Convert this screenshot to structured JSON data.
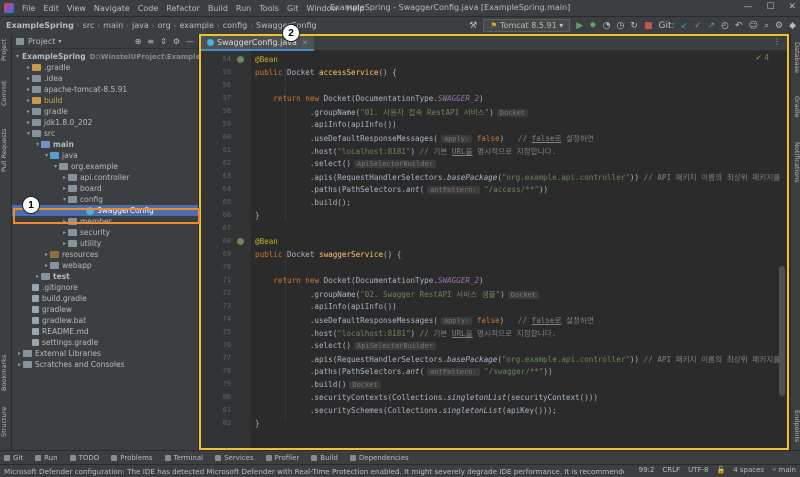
{
  "menu": {
    "items": [
      "File",
      "Edit",
      "View",
      "Navigate",
      "Code",
      "Refactor",
      "Build",
      "Run",
      "Tools",
      "Git",
      "Window",
      "Help"
    ],
    "title": "ExampleSpring - SwaggerConfig.java [ExampleSpring.main]"
  },
  "navbar": {
    "crumbs": [
      "ExampleSpring",
      "src",
      "main",
      "java",
      "org",
      "example",
      "config",
      "SwaggerConfig"
    ],
    "run_config": "Tomcat 8.5.91",
    "git_label": "Git:"
  },
  "left_strip": {
    "tabs": [
      "Project",
      "Commit",
      "Pull Requests",
      "Bookmarks",
      "Structure"
    ]
  },
  "right_strip": {
    "tabs": [
      "Database",
      "Gradle",
      "Notifications",
      "Endpoints"
    ]
  },
  "project_panel": {
    "title": "Project",
    "tree": [
      {
        "label": "ExampleSpring",
        "path": "D:\\WinstelUProject\\ExampleSpring",
        "indent": 0,
        "arrow": "▾",
        "icon": "fold-b",
        "bold": true
      },
      {
        "label": ".gradle",
        "indent": 1,
        "arrow": "▸",
        "icon": "fold-o"
      },
      {
        "label": ".idea",
        "indent": 1,
        "arrow": "▸",
        "icon": "fold"
      },
      {
        "label": "apache-tomcat-8.5.91",
        "indent": 1,
        "arrow": "▸",
        "icon": "fold"
      },
      {
        "label": "build",
        "indent": 1,
        "arrow": "▸",
        "icon": "fold-o",
        "highlight": true
      },
      {
        "label": "gradle",
        "indent": 1,
        "arrow": "▸",
        "icon": "fold"
      },
      {
        "label": "jdk1.8.0_202",
        "indent": 1,
        "arrow": "▸",
        "icon": "fold"
      },
      {
        "label": "src",
        "indent": 1,
        "arrow": "▾",
        "icon": "fold"
      },
      {
        "label": "main",
        "indent": 2,
        "arrow": "▾",
        "icon": "fold-b",
        "bold": true
      },
      {
        "label": "java",
        "indent": 3,
        "arrow": "▾",
        "icon": "fold-s"
      },
      {
        "label": "org.example",
        "indent": 4,
        "arrow": "▾",
        "icon": "fold"
      },
      {
        "label": "api.controller",
        "indent": 5,
        "arrow": "▸",
        "icon": "fold"
      },
      {
        "label": "board",
        "indent": 5,
        "arrow": "▸",
        "icon": "fold"
      },
      {
        "label": "config",
        "indent": 5,
        "arrow": "▾",
        "icon": "fold"
      },
      {
        "label": "SwaggerConfig",
        "indent": 7,
        "arrow": "",
        "icon": "jcls",
        "selected": true
      },
      {
        "label": "member",
        "indent": 5,
        "arrow": "▸",
        "icon": "fold"
      },
      {
        "label": "security",
        "indent": 5,
        "arrow": "▸",
        "icon": "fold"
      },
      {
        "label": "utility",
        "indent": 5,
        "arrow": "▸",
        "icon": "fold"
      },
      {
        "label": "resources",
        "indent": 3,
        "arrow": "▸",
        "icon": "fold-r"
      },
      {
        "label": "webapp",
        "indent": 3,
        "arrow": "▸",
        "icon": "fold"
      },
      {
        "label": "test",
        "indent": 2,
        "arrow": "▸",
        "icon": "fold",
        "bold": true
      },
      {
        "label": ".gitignore",
        "indent": 1,
        "arrow": "",
        "icon": "file"
      },
      {
        "label": "build.gradle",
        "indent": 1,
        "arrow": "",
        "icon": "file"
      },
      {
        "label": "gradlew",
        "indent": 1,
        "arrow": "",
        "icon": "file"
      },
      {
        "label": "gradlew.bat",
        "indent": 1,
        "arrow": "",
        "icon": "file"
      },
      {
        "label": "README.md",
        "indent": 1,
        "arrow": "",
        "icon": "file"
      },
      {
        "label": "settings.gradle",
        "indent": 1,
        "arrow": "",
        "icon": "file"
      },
      {
        "label": "External Libraries",
        "indent": 0,
        "arrow": "▸",
        "icon": "fold"
      },
      {
        "label": "Scratches and Consoles",
        "indent": 0,
        "arrow": "▸",
        "icon": "fold"
      }
    ]
  },
  "editor": {
    "tab_label": "SwaggerConfig.java",
    "analysis": "✔ 4",
    "line_numbers": [
      54,
      55,
      56,
      57,
      58,
      59,
      60,
      61,
      62,
      63,
      64,
      65,
      66,
      67,
      68,
      69,
      70,
      71,
      72,
      73,
      74,
      75,
      76,
      77,
      78,
      79,
      80,
      81,
      82
    ],
    "bean_lines": [
      54,
      68
    ],
    "lines": [
      [
        [
          "an",
          "@Bean"
        ]
      ],
      [
        [
          "kw",
          "public "
        ],
        [
          "",
          "Docket "
        ],
        [
          "fn",
          "accessService"
        ],
        [
          "",
          "() {"
        ]
      ],
      [],
      [
        [
          "",
          "    "
        ],
        [
          "kw",
          "return new "
        ],
        [
          "",
          "Docket(DocumentationType."
        ],
        [
          "it",
          "SWAGGER_2"
        ],
        [
          "",
          ")"
        ]
      ],
      [
        [
          "",
          "            .groupName("
        ],
        [
          "st",
          "\"01. 사용자 접속 RestAPI 서비스\""
        ],
        [
          "",
          ")"
        ],
        [
          "hint",
          "Docket"
        ]
      ],
      [
        [
          "",
          "            .apiInfo(apiInfo())"
        ]
      ],
      [
        [
          "",
          "            .useDefaultResponseMessages("
        ],
        [
          "hint",
          "apply:"
        ],
        [
          "kw",
          " false"
        ],
        [
          "",
          ")   "
        ],
        [
          "cm",
          "// "
        ],
        [
          "cm u",
          "false로"
        ],
        [
          "cm",
          " 설정하면"
        ]
      ],
      [
        [
          "",
          "            .host("
        ],
        [
          "st",
          "\"localhost:8181\""
        ],
        [
          "",
          ") "
        ],
        [
          "cm",
          "// 기본 "
        ],
        [
          "cm u",
          "URL을"
        ],
        [
          "cm",
          " 명시적으로 지정합니다."
        ]
      ],
      [
        [
          "",
          "            .select()"
        ],
        [
          "hint",
          "ApiSelectorBuilder"
        ]
      ],
      [
        [
          "",
          "            .apis(RequestHandlerSelectors."
        ],
        [
          "sti",
          "basePackage"
        ],
        [
          "",
          "("
        ],
        [
          "st",
          "\"org.example.api.controller\""
        ],
        [
          "",
          ")) "
        ],
        [
          "cm",
          "// API 패키지 이름의 최상위 패키지를 입력"
        ]
      ],
      [
        [
          "",
          "            .paths(PathSelectors."
        ],
        [
          "sti",
          "ant"
        ],
        [
          "",
          "("
        ],
        [
          "hint",
          "antPattern:"
        ],
        [
          "st",
          " \"/access/**\""
        ],
        [
          "",
          "))"
        ]
      ],
      [
        [
          "",
          "            .build();"
        ]
      ],
      [
        [
          "",
          "}"
        ]
      ],
      [],
      [
        [
          "an",
          "@Bean"
        ]
      ],
      [
        [
          "kw",
          "public "
        ],
        [
          "",
          "Docket "
        ],
        [
          "fn",
          "swaggerService"
        ],
        [
          "",
          "() {"
        ]
      ],
      [],
      [
        [
          "",
          "    "
        ],
        [
          "kw",
          "return new "
        ],
        [
          "",
          "Docket(DocumentationType."
        ],
        [
          "it",
          "SWAGGER_2"
        ],
        [
          "",
          ")"
        ]
      ],
      [
        [
          "",
          "            .groupName("
        ],
        [
          "st",
          "\"02. Swagger RestAPI 서비스 샘플\""
        ],
        [
          "",
          ")"
        ],
        [
          "hint",
          "Docket"
        ]
      ],
      [
        [
          "",
          "            .apiInfo(apiInfo())"
        ]
      ],
      [
        [
          "",
          "            .useDefaultResponseMessages("
        ],
        [
          "hint",
          "apply:"
        ],
        [
          "kw",
          " false"
        ],
        [
          "",
          ")   "
        ],
        [
          "cm",
          "// "
        ],
        [
          "cm u",
          "false로"
        ],
        [
          "cm",
          " 설정하면"
        ]
      ],
      [
        [
          "",
          "            .host("
        ],
        [
          "st",
          "\"localhost:8181\""
        ],
        [
          "",
          ") "
        ],
        [
          "cm",
          "// 기본 "
        ],
        [
          "cm u",
          "URL을"
        ],
        [
          "cm",
          " 명시적으로 지정합니다."
        ]
      ],
      [
        [
          "",
          "            .select()"
        ],
        [
          "hint",
          "ApiSelectorBuilder"
        ]
      ],
      [
        [
          "",
          "            .apis(RequestHandlerSelectors."
        ],
        [
          "sti",
          "basePackage"
        ],
        [
          "",
          "("
        ],
        [
          "st",
          "\"org.example.api.controller\""
        ],
        [
          "",
          ")) "
        ],
        [
          "cm",
          "// API 패키지 이름의 최상위 패키지를"
        ]
      ],
      [
        [
          "",
          "            .paths(PathSelectors."
        ],
        [
          "sti",
          "ant"
        ],
        [
          "",
          "("
        ],
        [
          "hint",
          "antPattern:"
        ],
        [
          "st",
          " \"/swagger/**\""
        ],
        [
          "",
          "))"
        ]
      ],
      [
        [
          "",
          "            .build()"
        ],
        [
          "hint",
          "Docket"
        ]
      ],
      [
        [
          "",
          "            .securityContexts(Collections."
        ],
        [
          "sti",
          "singletonList"
        ],
        [
          "",
          "(securityContext()))"
        ]
      ],
      [
        [
          "",
          "            .securitySchemes(Collections."
        ],
        [
          "sti",
          "singletonList"
        ],
        [
          "",
          "(apiKey()));"
        ]
      ],
      [
        [
          "",
          "}"
        ]
      ]
    ]
  },
  "annotations": {
    "badge1": "1",
    "badge2": "2"
  },
  "bottom_tabs": [
    "Git",
    "Run",
    "TODO",
    "Problems",
    "Terminal",
    "Services",
    "Profiler",
    "Build",
    "Dependencies"
  ],
  "status": {
    "message": "Microsoft Defender configuration: The IDE has detected Microsoft Defender with Real-Time Protection enabled. It might severely degrade IDE performance. It is recommended to a... (7 minutes a",
    "position": "99:2",
    "line_sep": "CRLF",
    "encoding": "UTF-8",
    "indent": "4 spaces",
    "branch": "main"
  },
  "colors": {
    "accent": "#4b6eaf",
    "highlight_yellow": "#f2c12e",
    "highlight_orange": "#f08a2b"
  }
}
